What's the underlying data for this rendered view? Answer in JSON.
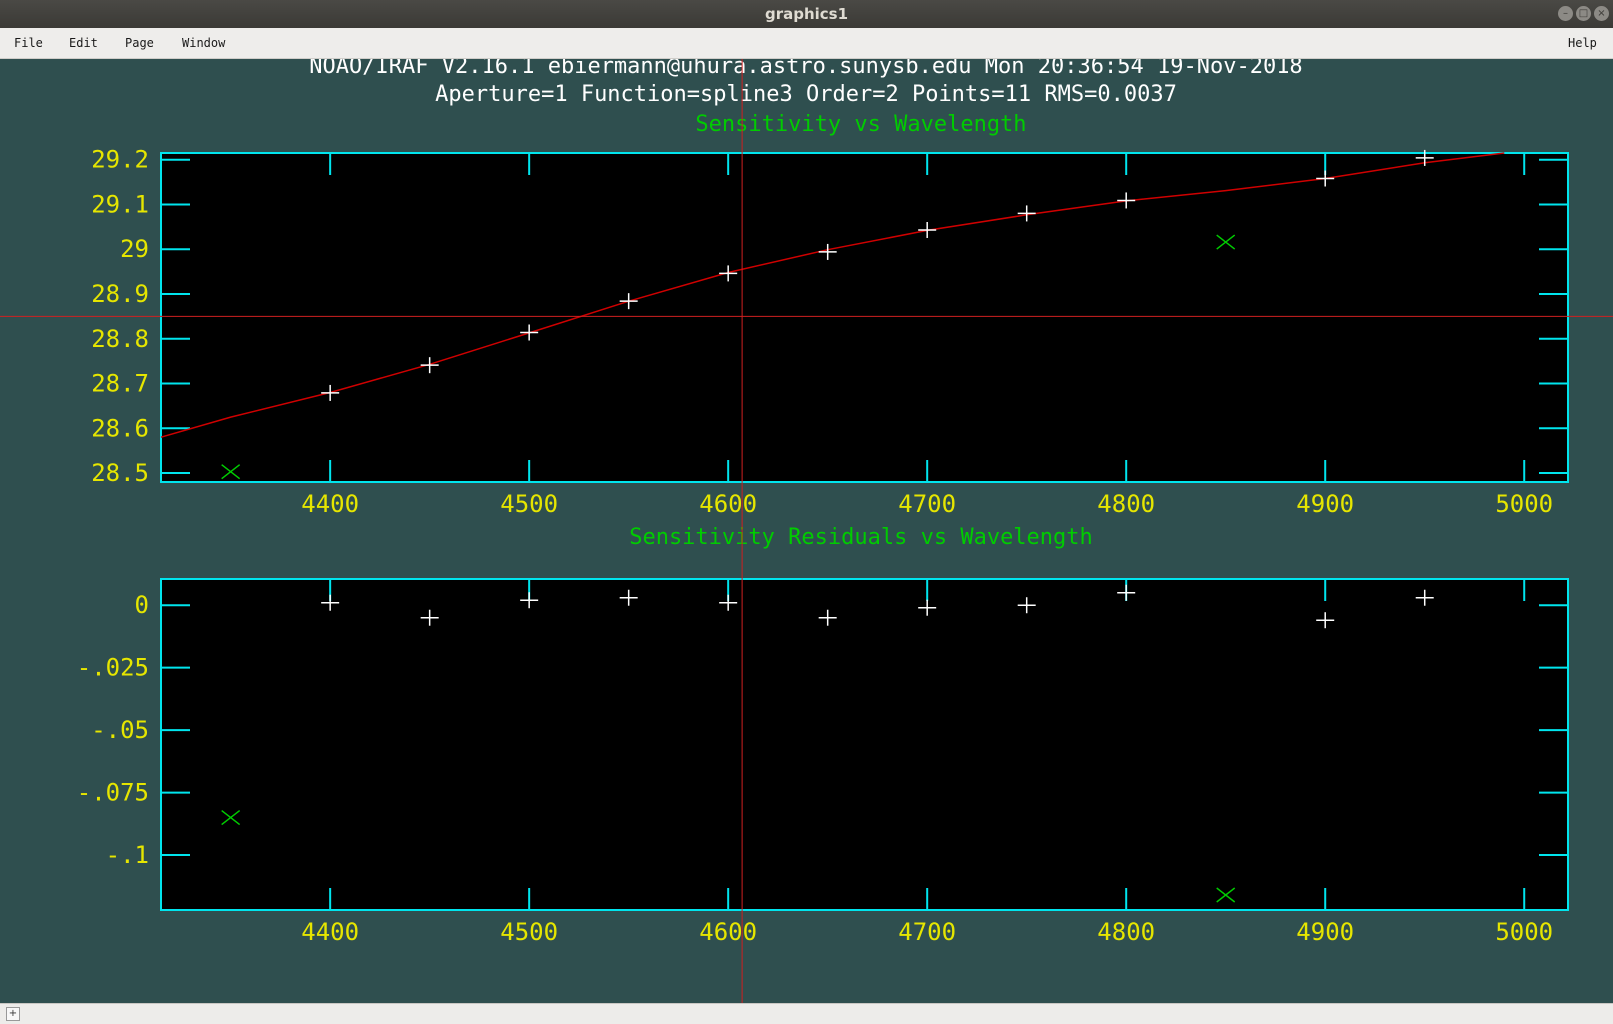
{
  "window": {
    "title": "graphics1",
    "menus": [
      "File",
      "Edit",
      "Page",
      "Window"
    ],
    "help": "Help",
    "resize_glyph": "+"
  },
  "header": {
    "line1": "NOAO/IRAF V2.16.1 ebiermann@uhura.astro.sunysb.edu Mon 20:36:54 19-Nov-2018",
    "line2": "Aperture=1  Function=spline3  Order=2  Points=11  RMS=0.0037"
  },
  "colors": {
    "background": "#2f4f4f",
    "axes": "#00e5ee",
    "ticklabels": "#e6e600",
    "title": "#00cc00",
    "fit": "#d00000",
    "points": "#ffffff",
    "rejected": "#00cc00",
    "cursor": "#d02020"
  },
  "chart_data": [
    {
      "type": "scatter",
      "title": "Sensitivity vs Wavelength",
      "xlim": [
        4315,
        5022
      ],
      "ylim": [
        28.48,
        29.215
      ],
      "xticks": [
        4400,
        4500,
        4600,
        4700,
        4800,
        4900,
        5000
      ],
      "xticklabels": [
        "4400",
        "4500",
        "4600",
        "4700",
        "4800",
        "4900",
        "5000"
      ],
      "yticks": [
        28.5,
        28.6,
        28.7,
        28.8,
        28.9,
        29.0,
        29.1,
        29.2
      ],
      "yticklabels": [
        "28.5",
        "28.6",
        "28.7",
        "28.8",
        "28.9",
        "29",
        "29.1",
        "29.2"
      ],
      "points": {
        "x": [
          4400,
          4450,
          4500,
          4550,
          4600,
          4650,
          4700,
          4750,
          4800,
          4900,
          4950
        ],
        "y": [
          28.679,
          28.741,
          28.814,
          28.884,
          28.946,
          28.994,
          29.043,
          29.08,
          29.109,
          29.158,
          29.204
        ]
      },
      "rejected": {
        "x": [
          4350,
          4850
        ],
        "y": [
          28.503,
          29.016
        ]
      },
      "fit": {
        "x": [
          4315,
          4350,
          4400,
          4450,
          4500,
          4550,
          4600,
          4650,
          4700,
          4750,
          4800,
          4850,
          4900,
          4950,
          4990
        ],
        "y": [
          28.58,
          28.625,
          28.68,
          28.743,
          28.813,
          28.884,
          28.948,
          28.999,
          29.042,
          29.077,
          29.108,
          29.131,
          29.158,
          29.193,
          29.215
        ]
      },
      "cursor": {
        "x": 4607,
        "y": 28.85
      }
    },
    {
      "type": "scatter",
      "title": "Sensitivity Residuals vs Wavelength",
      "xlim": [
        4315,
        5022
      ],
      "ylim": [
        -0.122,
        0.0105
      ],
      "xticks": [
        4400,
        4500,
        4600,
        4700,
        4800,
        4900,
        5000
      ],
      "xticklabels": [
        "4400",
        "4500",
        "4600",
        "4700",
        "4800",
        "4900",
        "5000"
      ],
      "yticks": [
        0,
        -0.025,
        -0.05,
        -0.075,
        -0.1
      ],
      "yticklabels": [
        "0",
        "-.025",
        "-.05",
        "-.075",
        "-.1"
      ],
      "points": {
        "x": [
          4400,
          4450,
          4500,
          4550,
          4600,
          4650,
          4700,
          4750,
          4800,
          4900,
          4950
        ],
        "y": [
          0.001,
          -0.005,
          0.002,
          0.003,
          0.001,
          -0.005,
          -0.001,
          0.0,
          0.005,
          -0.006,
          0.003
        ]
      },
      "rejected": {
        "x": [
          4350,
          4850
        ],
        "y": [
          -0.085,
          -0.116
        ]
      },
      "cursor": {
        "x": 4607
      }
    }
  ]
}
